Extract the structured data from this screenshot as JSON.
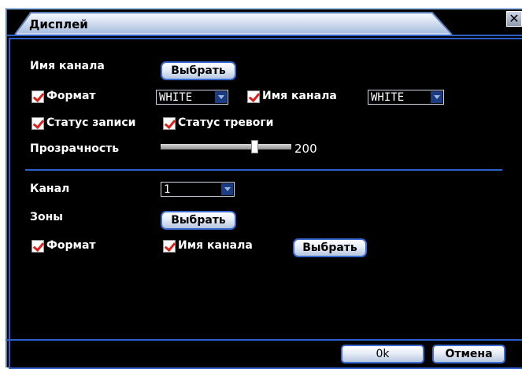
{
  "window": {
    "title": "Дисплей",
    "close_glyph": "✕"
  },
  "display_section": {
    "channel_name_label": "Имя канала",
    "channel_name_button": "Выбрать",
    "format_checkbox_label": "Формат",
    "format_checked": true,
    "format_color_value": "WHITE",
    "channel_name_checkbox_label": "Имя канала",
    "channel_name_checked": true,
    "channel_name_color_value": "WHITE",
    "record_status_label": "Статус записи",
    "record_status_checked": true,
    "alarm_status_label": "Статус тревоги",
    "alarm_status_checked": true,
    "transparency_label": "Прозрачность",
    "transparency_value": "200",
    "transparency_fraction": 0.72
  },
  "channel_section": {
    "channel_label": "Канал",
    "channel_value": "1",
    "zones_label": "Зоны",
    "zones_button": "Выбрать",
    "format_checkbox_label": "Формат",
    "format_checked": true,
    "channel_name_checkbox_label": "Имя канала",
    "channel_name_checked": true,
    "channel_name_button": "Выбрать"
  },
  "footer": {
    "ok_button": "0k",
    "cancel_button": "Отмена"
  },
  "colors": {
    "background": "#000000",
    "accent_border": "#2f60c8",
    "checkmark": "#e0201a",
    "text": "#ffffff"
  },
  "icons": {
    "checkbox": "checkmark-icon",
    "dropdown": "chevron-down-icon",
    "close": "close-icon"
  }
}
